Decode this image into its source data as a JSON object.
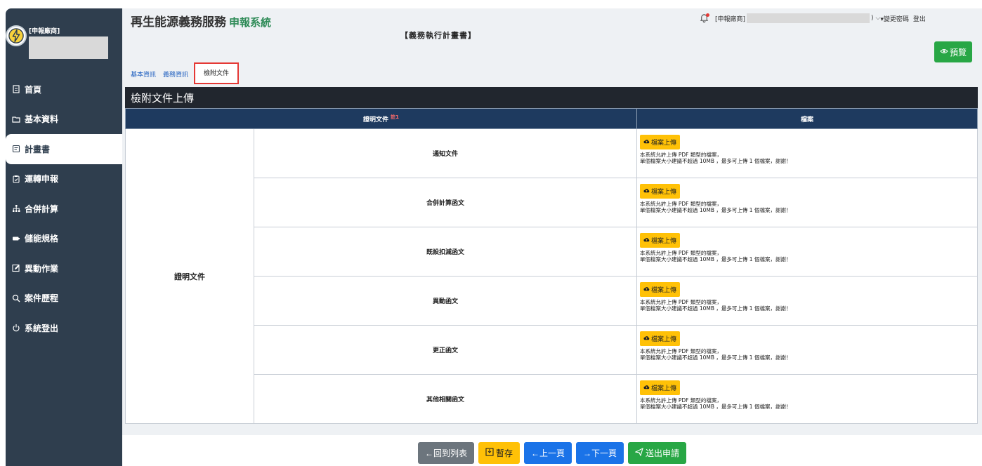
{
  "sidebar": {
    "vendor_label": "[申報廠商]",
    "items": [
      {
        "label": "首頁",
        "icon": "document-icon"
      },
      {
        "label": "基本資料",
        "icon": "folder-icon"
      },
      {
        "label": "計畫書",
        "icon": "list-icon",
        "active": true
      },
      {
        "label": "運轉申報",
        "icon": "clipboard-icon"
      },
      {
        "label": "合併計算",
        "icon": "sitemap-icon"
      },
      {
        "label": "儲能規格",
        "icon": "battery-icon"
      },
      {
        "label": "異動作業",
        "icon": "edit-icon"
      },
      {
        "label": "案件歷程",
        "icon": "search-icon"
      },
      {
        "label": "系統登出",
        "icon": "power-icon"
      }
    ]
  },
  "header": {
    "brand": "再生能源義務服務",
    "brand_sub": "申報系統",
    "page_title": "【義務執行計畫書】",
    "user_prefix": "[申報廠商]",
    "user_suffix": ")",
    "change_password": "▾變更密碼",
    "logout": "登出",
    "preview": "預覽"
  },
  "tabs": [
    {
      "label": "基本資訊"
    },
    {
      "label": "義務資訊"
    },
    {
      "label": "檢附文件",
      "active": true
    }
  ],
  "section": {
    "title": "檢附文件上傳"
  },
  "table": {
    "col_doc": "證明文件",
    "col_doc_note": "註1",
    "col_file": "檔案",
    "group_label": "證明文件",
    "upload_label": "檔案上傳",
    "note_line1": "本系統允許上傳 PDF 類型的檔案，",
    "note_line2": "單個檔案大小建議不超過 10MB ，最多可上傳 1 個檔案，謝謝！",
    "rows": [
      {
        "doc": "通知文件"
      },
      {
        "doc": "合併計算函文"
      },
      {
        "doc": "既設扣減函文"
      },
      {
        "doc": "異動函文"
      },
      {
        "doc": "更正函文"
      },
      {
        "doc": "其他相關函文"
      }
    ]
  },
  "footer": {
    "back_list": "←回到列表",
    "save": "暫存",
    "prev": "←上一頁",
    "next": "→下一頁",
    "submit": "送出申請"
  },
  "colors": {
    "sidebar": "#2f3e4e",
    "accent_green": "#28a745",
    "upload_yellow": "#ffc107",
    "table_header": "#1e3a5f",
    "section_bar": "#21262e",
    "tab_highlight": "#e53935"
  }
}
